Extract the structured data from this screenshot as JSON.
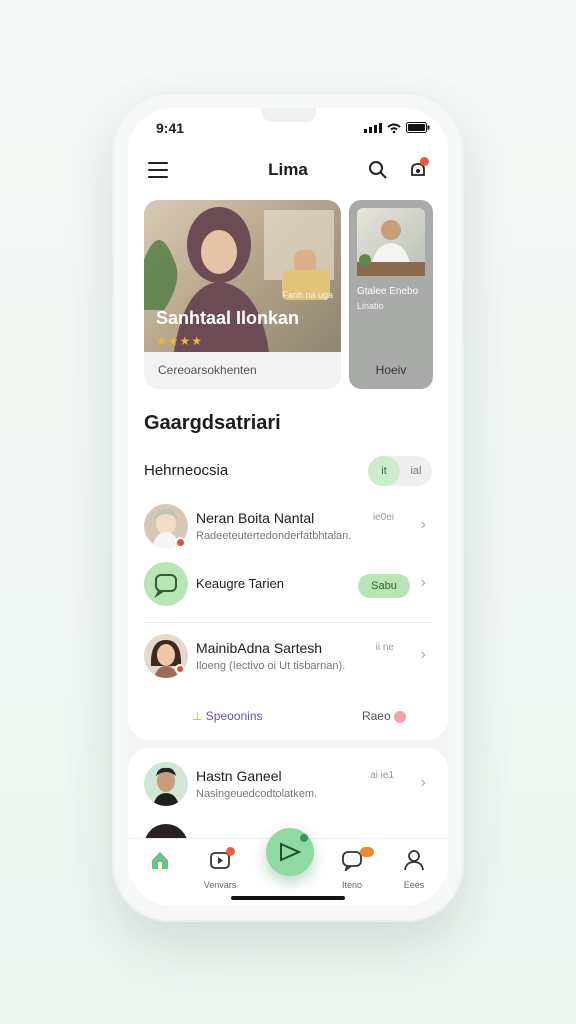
{
  "status_bar": {
    "time": "9:41"
  },
  "header": {
    "title": "Lima"
  },
  "featured": {
    "title": "Sanhtaal Ilonkan",
    "overlay_text": "Fanh na uga",
    "stars": "★★★★",
    "caption": "Cereoarsokhenten"
  },
  "featured_secondary": {
    "line1": "Gtalee Enebo",
    "line2": "Linatio",
    "button": "Hoeiv"
  },
  "section": {
    "title": "Gaargdsatriari",
    "subtitle": "Hehrneocsia",
    "toggle": [
      "it",
      "ial"
    ]
  },
  "list": [
    {
      "name": "Neran Boita Nantal",
      "sub": "Radeeteutertedonderfatbhtalan.",
      "time": "ie0ei"
    },
    {
      "name": "Keaugre Tarien",
      "pill": "Sabu"
    },
    {
      "name": "MainibAdna Sartesh",
      "sub": "Iloeng (Iectivo oi Ut tisbarnan).",
      "time": "ii ne"
    }
  ],
  "footer": {
    "left": "Speoonins",
    "right": "Raeo"
  },
  "secondary_list": [
    {
      "name": "Hastn Ganeel",
      "sub": "Nasingeuedcodtolatkem.",
      "time": "ai ie1"
    }
  ],
  "tabs": [
    {
      "label": ""
    },
    {
      "label": "Venvars"
    },
    {
      "label": "Iteno"
    },
    {
      "label": "Eees"
    }
  ],
  "colors": {
    "accent": "#8fdaa3",
    "badge": "#ef5b3a"
  }
}
